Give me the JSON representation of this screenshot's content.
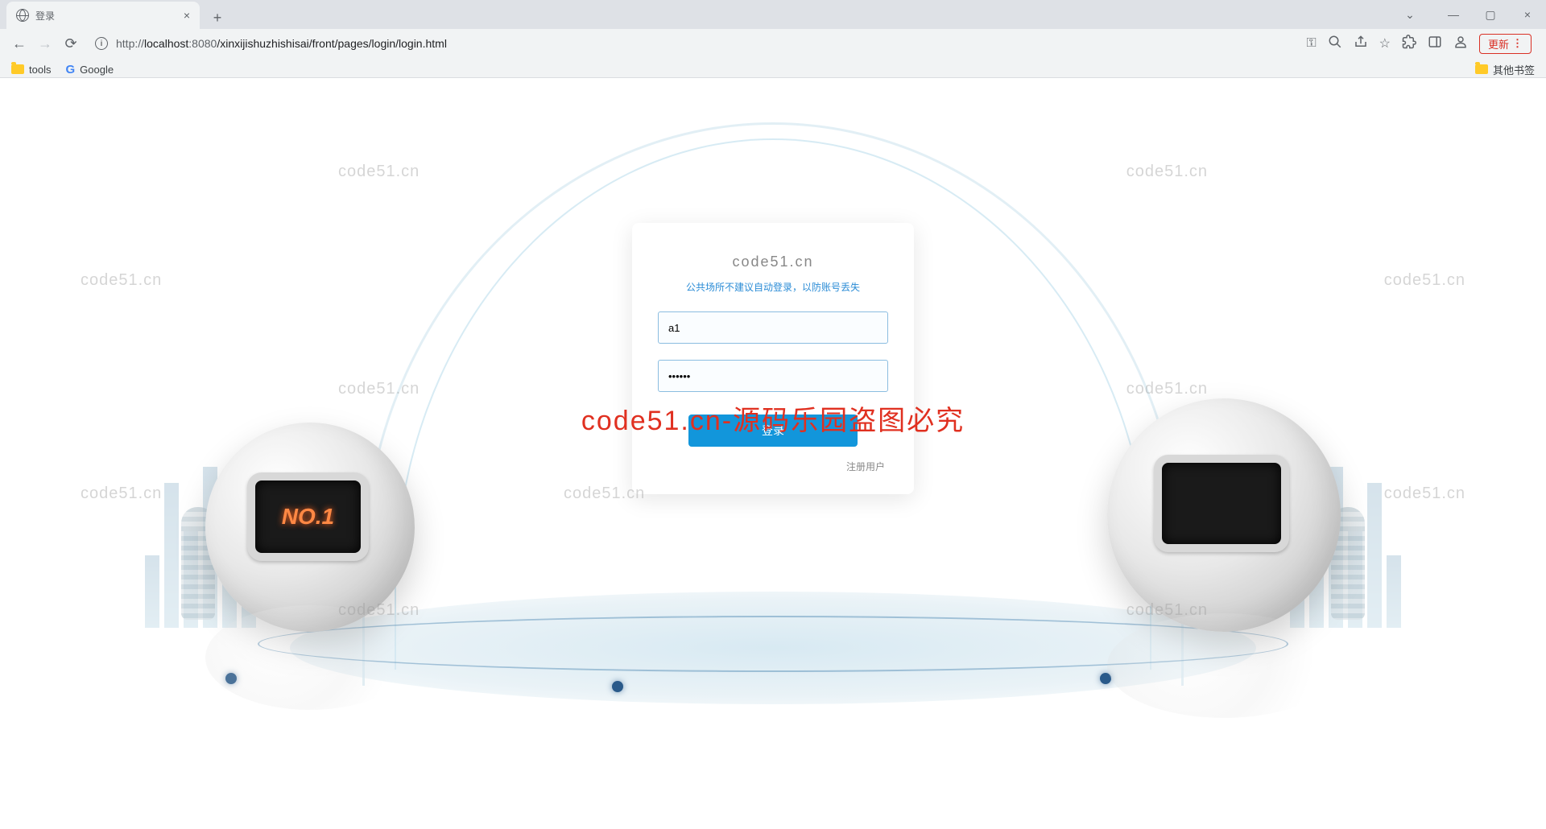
{
  "browser": {
    "tab_title": "登录",
    "url_host": "localhost",
    "url_port": ":8080",
    "url_path": "/xinxijishuzhishisai/front/pages/login/login.html",
    "url_prefix": "http://",
    "update_label": "更新",
    "bookmarks": {
      "tools": "tools",
      "google": "Google",
      "other": "其他书签"
    }
  },
  "login": {
    "hint": "公共场所不建议自动登录，以防账号丢失",
    "username_value": "a1",
    "password_value": "••••••",
    "button_label": "登录",
    "register_label": "注册用户"
  },
  "robot_left_text": "NO.1",
  "watermark": {
    "text": "code51.cn",
    "big": "code51.cn-源码乐园盗图必究"
  }
}
